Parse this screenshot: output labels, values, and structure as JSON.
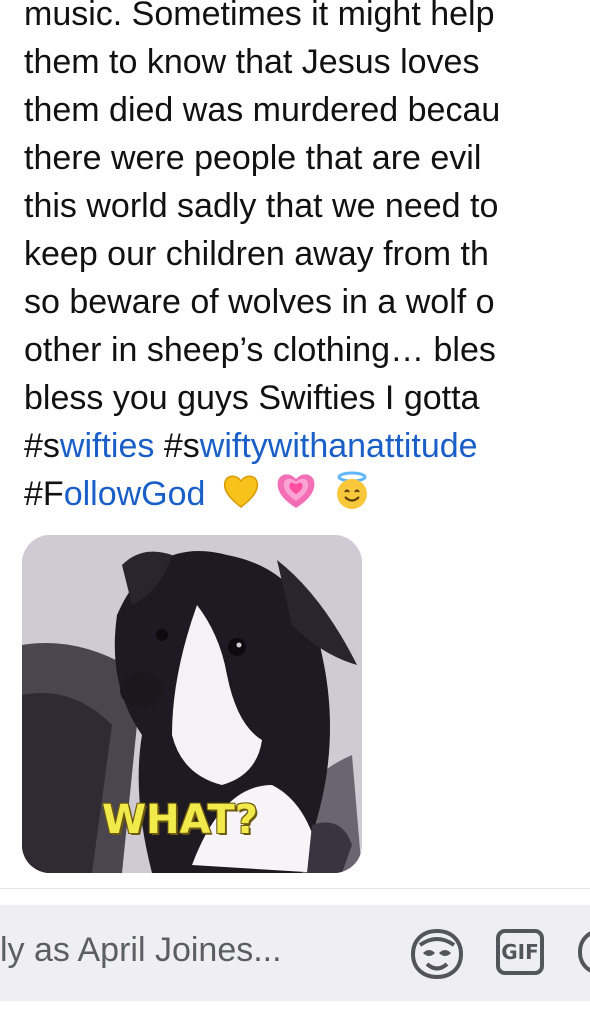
{
  "post": {
    "lines": [
      "music. Sometimes it might help",
      "them to know that Jesus loves",
      "them died was murdered becau",
      "there were people that are evil",
      "this world sadly that we need to",
      "keep our children away from th",
      "so beware of wolves in a wolf o",
      "other in sheep’s clothing… bles",
      "bless you guys Swifties  I gotta"
    ],
    "hashtags": {
      "swifties": {
        "lead": "#s",
        "rest": "wifties"
      },
      "swiftywithanattitude": {
        "lead": "#s",
        "rest": "wiftywithanattitude"
      },
      "followgod": {
        "lead": "#F",
        "rest": "ollowGod"
      }
    },
    "emojis": [
      "yellow-heart-emoji",
      "growing-heart-emoji",
      "halo-smile-emoji"
    ]
  },
  "gif": {
    "caption": "WHAT?"
  },
  "composer": {
    "placeholder": "ly as April Joines...",
    "icons": [
      "sticker-face-icon",
      "gif-icon"
    ],
    "gif_label": "GIF"
  },
  "colors": {
    "hashtag": "#1a5fc8",
    "text": "#111111",
    "composer_bg": "#efeff2",
    "caption": "#f2e94a"
  }
}
